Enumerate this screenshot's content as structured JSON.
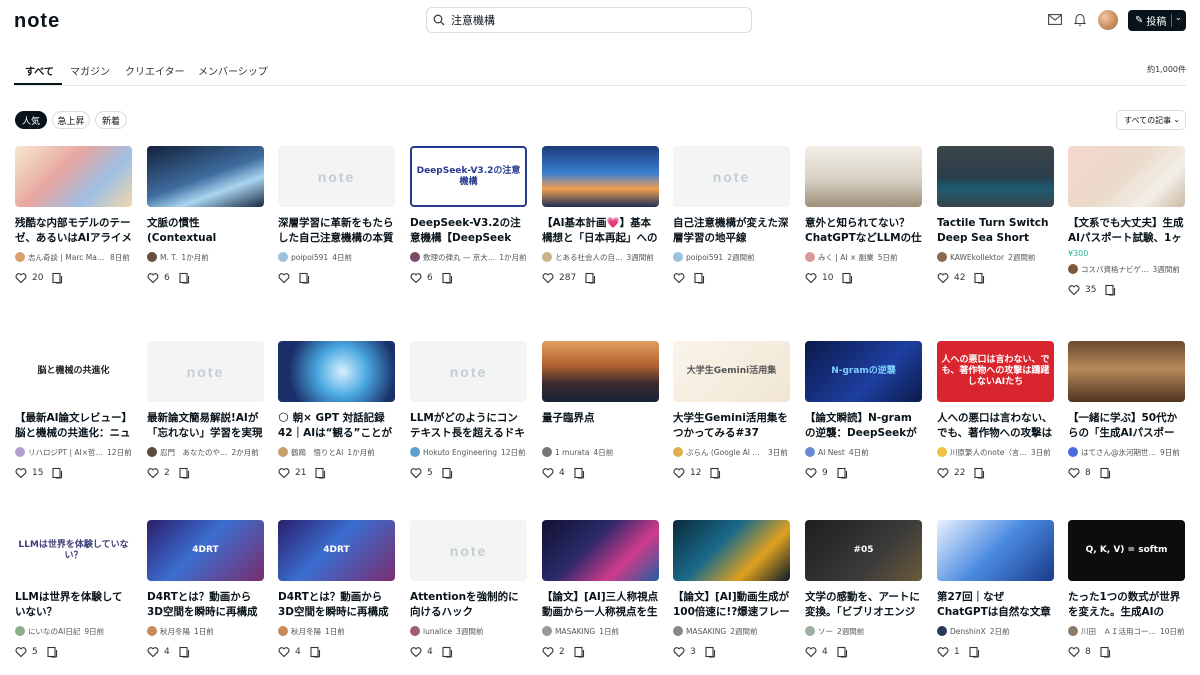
{
  "header": {
    "logo": "note",
    "search_value": "注意機構",
    "post_label": "投稿"
  },
  "tabs": [
    "すべて",
    "マガジン",
    "クリエイター",
    "メンバーシップ"
  ],
  "result_count": "約1,000件",
  "filters": [
    "人気",
    "急上昇",
    "新着"
  ],
  "sort_label": "すべての記事",
  "cards": [
    {
      "title": "残酷な内部モデルのテーゼ、あるいはAIアライメント問題を「異種間パレー…",
      "author": "志ん奇談 | Marc Masa…",
      "time": "8日前",
      "likes": "20"
    },
    {
      "title": "文脈の慣性(Contextual Inertia)：なぜAIは「空気」を読み違えるのか——…",
      "author": "M. T.",
      "time": "1か月前",
      "likes": "6"
    },
    {
      "title": "深層学習に革新をもたらした自己注意機構の本質",
      "author": "poipoi591",
      "time": "4日前",
      "likes": ""
    },
    {
      "title": "DeepSeek-V3.2の注意機構【DeepSeek Sparse Attention】",
      "author": "数理の弾丸 — 京大…",
      "time": "1か月前",
      "likes": "6"
    },
    {
      "title": "【AI基本計画💗】基本構想と「日本再起」へのロードマップ🌅：G検定合格…",
      "author": "とある社会人の自…",
      "time": "3週間前",
      "likes": "287"
    },
    {
      "title": "自己注意機構が変えた深層学習の地平線",
      "author": "poipoi591",
      "time": "2週間前",
      "likes": ""
    },
    {
      "title": "意外と知られてない？ChatGPTなどLLMの仕組み",
      "author": "みく | AI × 副業",
      "time": "5日前",
      "likes": "10"
    },
    {
      "title": "Tactile Turn Switch Deep Sea Short",
      "author": "KAWEkollektor",
      "time": "2週間前",
      "likes": "42"
    },
    {
      "title": "【文系でも大丈夫】生成AIパスポート試験、1ヶ月で合格する勉強法と「落ち…",
      "author": "コスパ資格ナビゲ…",
      "time": "3週間前",
      "likes": "35",
      "price": "¥300"
    },
    {
      "title": "【最新AI論文レビュー】脳と機械の共進化：ニューロロボティクスが描く「動…",
      "author": "リハロジPT | AI×哲…",
      "time": "12日前",
      "likes": "15"
    },
    {
      "title": "最新論文簡易解説!AIが「忘れない」学習を実現する革新技術「クエリのみ…",
      "author": "忍門　あなたのや…",
      "time": "2か月前",
      "likes": "2"
    },
    {
      "title": "🌕 朝× GPT 対話記録42｜AIは“観る”ことができるのか？｜ AIに意識は…",
      "author": "鶴鴎　悟りとAI",
      "time": "1か月前",
      "likes": "21"
    },
    {
      "title": "LLMがどのようにコンテキスト長を超えるドキュメントを理解しているか…",
      "author": "Hokuto Engineering",
      "time": "12日前",
      "likes": "5"
    },
    {
      "title": "量子臨界点",
      "author": "1 murata",
      "time": "4日前",
      "likes": "4"
    },
    {
      "title": "大学生Gemini活用集をつかってみる#37",
      "author": "ぷらん (Google AI 学…",
      "time": "3日前",
      "likes": "12"
    },
    {
      "title": "【論文瞬読】N-gramの逆襲：DeepSeekが提案する「条件付きメモリ」で…",
      "author": "AI Nest",
      "time": "4日前",
      "likes": "9"
    },
    {
      "title": "人への悪口は言わない、でも、著作物への攻撃は躊躇しないAIたち",
      "author": "川原繁人のnote（言…",
      "time": "3日前",
      "likes": "22"
    },
    {
      "title": "【一緒に学ぶ】50代からの「生成AIパスポート」完全攻略[Vol.5(全18)］…",
      "author": "はてさん@氷河期世…",
      "time": "9日前",
      "likes": "8"
    },
    {
      "title": "LLMは世界を体験していない？",
      "author": "にいなのAI日記",
      "time": "9日前",
      "likes": "5"
    },
    {
      "title": "D4RTとは？動画から3D空間を瞬時に再構成する AI技術の仕組みと応用",
      "author": "秋月冬陽",
      "time": "1日前",
      "likes": "4"
    },
    {
      "title": "D4RTとは？動画から3D空間を瞬時に再構成する AI技術の仕組みと応用",
      "author": "秋月冬陽",
      "time": "1日前",
      "likes": "4"
    },
    {
      "title": "Attentionを強制的に向けるハック",
      "author": "lunalice",
      "time": "3週間前",
      "likes": "4"
    },
    {
      "title": "【論文】[AI]三人称視点動画から一人称視点を生成!新技術「EgoX」とは?",
      "author": "MASAKING",
      "time": "1日前",
      "likes": "2"
    },
    {
      "title": "【論文】[AI]動画生成が100倍速に!?爆速フレームワーク…",
      "author": "MASAKING",
      "time": "2週間前",
      "likes": "3"
    },
    {
      "title": "文学の感動を、アートに変換。「ビブリオエンジン」開発記録#05",
      "author": "ソー",
      "time": "2週間前",
      "likes": "4"
    },
    {
      "title": "第27回｜なぜChatGPTは自然な文章を書けるのか?Transformerとは",
      "author": "DenshinX",
      "time": "2日前",
      "likes": "1"
    },
    {
      "title": "たった1つの数式が世界を変えた。生成AIの「魂」と「肉体」を読み解く",
      "author": "川田　ＡＩ活用コー…",
      "time": "10日前",
      "likes": "8"
    }
  ],
  "thumb_texts": {
    "t3": "DeepSeek-V3.2の注意機構",
    "t9": "脳と機械の共進化",
    "t14": "大学生Gemini活用集",
    "t15": "N-gramの逆襲",
    "t16": "人への悪口は言わない、でも、著作物への攻撃は躊躇しないAIたち",
    "t18": "LLMは世界を体験していない？",
    "t19": "4DRT",
    "t20": "4DRT",
    "t24": "#05",
    "t26": "Q, K, V) = softm",
    "placeholder": "note"
  },
  "colors": {
    "accent": "#2cb696",
    "ink": "#08131a"
  }
}
